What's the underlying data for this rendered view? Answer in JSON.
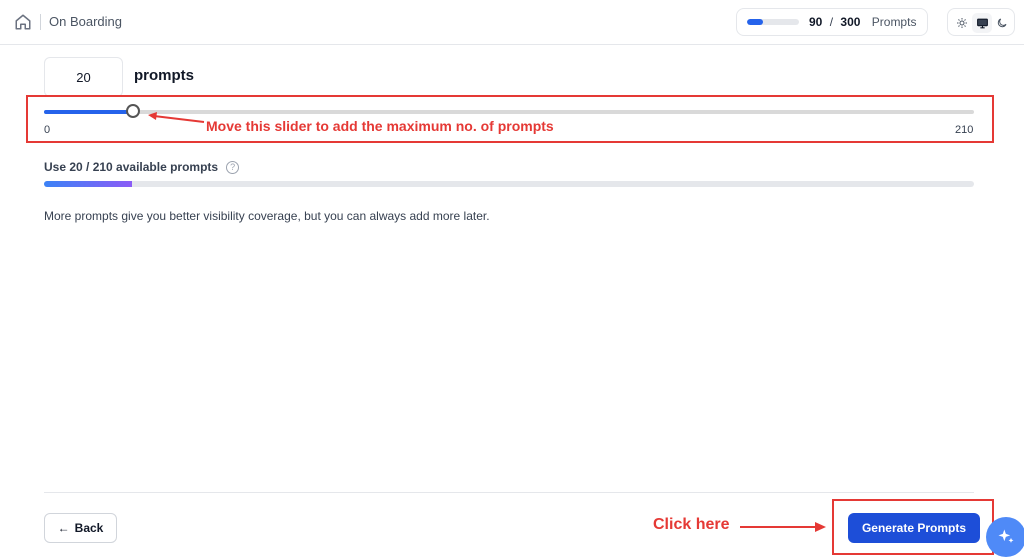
{
  "header": {
    "breadcrumb": "On Boarding",
    "usage": {
      "used": "90",
      "separator": "/",
      "total": "300",
      "label": "Prompts",
      "fraction": 0.3
    },
    "theme_options": [
      "light-icon",
      "monitor-icon",
      "moon-icon"
    ]
  },
  "main": {
    "count_value": "20",
    "count_unit": "prompts",
    "slider": {
      "min_label": "0",
      "max_label": "210",
      "value": 20,
      "max": 210
    },
    "available_label": "Use 20 / 210 available prompts",
    "help_glyph": "?",
    "available_fraction": 0.095,
    "info": "More prompts give you better visibility coverage, but you can always add more later."
  },
  "annotations": {
    "slider_note": "Move this slider to add the maximum no. of prompts",
    "click_note": "Click here"
  },
  "footer": {
    "back_label": "Back",
    "back_arrow": "←",
    "generate_label": "Generate Prompts"
  },
  "colors": {
    "accent": "#1d4ed8",
    "annotation": "#e53935"
  }
}
